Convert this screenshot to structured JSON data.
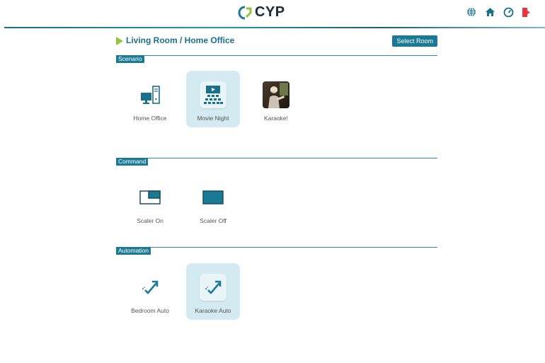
{
  "header": {
    "logo_text": "CYP",
    "icons": [
      "language-icon",
      "home-icon",
      "dashboard-icon",
      "logout-icon"
    ]
  },
  "room": {
    "title": "Living Room / Home Office",
    "select_label": "Select Room"
  },
  "sections": {
    "scenario": {
      "label": "Scenario",
      "items": [
        {
          "label": "Home Office",
          "icon": "computer-icon",
          "active": false
        },
        {
          "label": "Movie Night",
          "icon": "theater-icon",
          "active": true
        },
        {
          "label": "Karaoke!",
          "icon": "karaoke-photo",
          "active": false
        }
      ]
    },
    "command": {
      "label": "Command",
      "items": [
        {
          "label": "Scaler On",
          "icon": "scaler-on-icon",
          "active": false
        },
        {
          "label": "Scaler Off",
          "icon": "scaler-off-icon",
          "active": false
        }
      ]
    },
    "automation": {
      "label": "Automation",
      "items": [
        {
          "label": "Bedroom Auto",
          "icon": "automation-icon",
          "active": false
        },
        {
          "label": "Karaoke Auto",
          "icon": "automation-icon",
          "active": true
        }
      ]
    }
  },
  "colors": {
    "accent": "#1a7a96",
    "arrow": "#8ec63f",
    "active_tile": "#d3eaf1",
    "logout": "#e8383d"
  }
}
